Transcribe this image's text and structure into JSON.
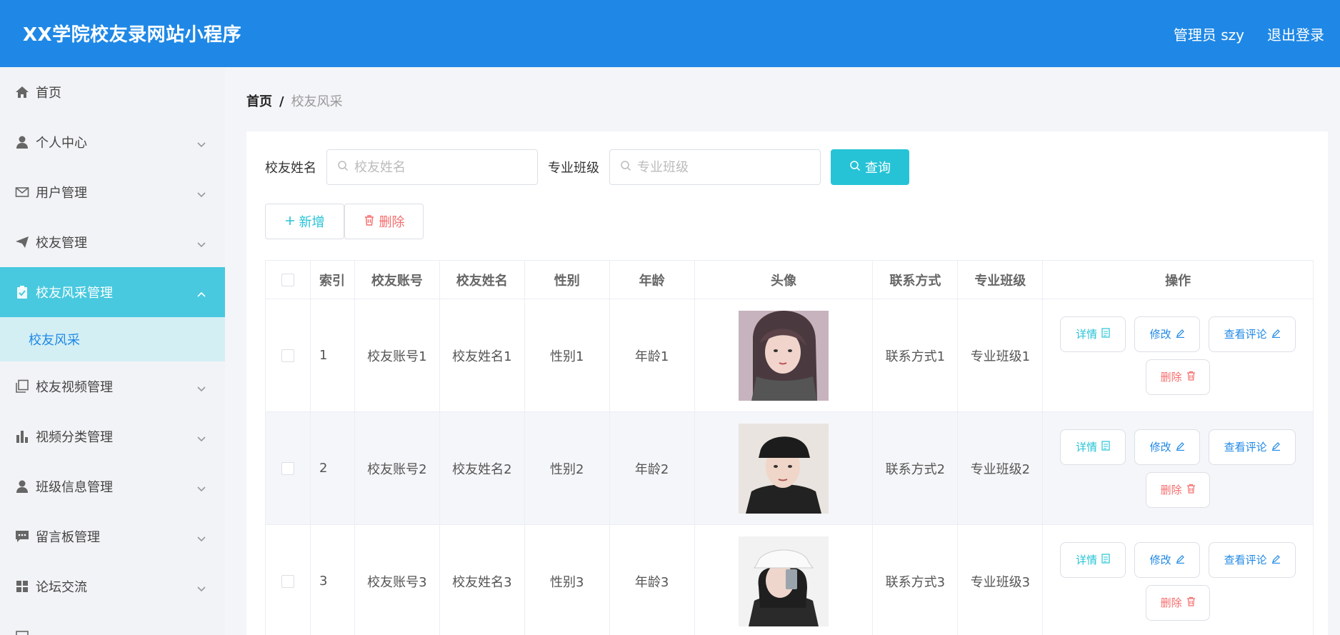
{
  "header": {
    "title": "XX学院校友录网站小程序",
    "user": "管理员 szy",
    "logout": "退出登录"
  },
  "sidebar": {
    "items": [
      {
        "label": "首页",
        "icon": "home-icon"
      },
      {
        "label": "个人中心",
        "icon": "user-icon"
      },
      {
        "label": "用户管理",
        "icon": "mail-icon"
      },
      {
        "label": "校友管理",
        "icon": "send-icon"
      },
      {
        "label": "校友风采管理",
        "icon": "clipboard-icon"
      },
      {
        "label": "校友视频管理",
        "icon": "copy-icon"
      },
      {
        "label": "视频分类管理",
        "icon": "bar-chart-icon"
      },
      {
        "label": "班级信息管理",
        "icon": "user-icon"
      },
      {
        "label": "留言板管理",
        "icon": "message-icon"
      },
      {
        "label": "论坛交流",
        "icon": "grid-icon"
      }
    ],
    "active_sub": "校友风采"
  },
  "breadcrumb": {
    "home": "首页",
    "sep": "/",
    "current": "校友风采"
  },
  "search": {
    "name_label": "校友姓名",
    "name_placeholder": "校友姓名",
    "class_label": "专业班级",
    "class_placeholder": "专业班级",
    "query_label": "查询"
  },
  "actions": {
    "add_label": "新增",
    "delete_label": "删除"
  },
  "table": {
    "headers": [
      "索引",
      "校友账号",
      "校友姓名",
      "性别",
      "年龄",
      "头像",
      "联系方式",
      "专业班级",
      "操作"
    ],
    "rows": [
      {
        "index": "1",
        "account": "校友账号1",
        "name": "校友姓名1",
        "gender": "性别1",
        "age": "年龄1",
        "contact": "联系方式1",
        "class": "专业班级1"
      },
      {
        "index": "2",
        "account": "校友账号2",
        "name": "校友姓名2",
        "gender": "性别2",
        "age": "年龄2",
        "contact": "联系方式2",
        "class": "专业班级2"
      },
      {
        "index": "3",
        "account": "校友账号3",
        "name": "校友姓名3",
        "gender": "性别3",
        "age": "年龄3",
        "contact": "联系方式3",
        "class": "专业班级3"
      }
    ],
    "ops": {
      "detail": "详情",
      "edit": "修改",
      "comment": "查看评论",
      "delete": "删除"
    }
  },
  "colors": {
    "header_bg": "#1f88e6",
    "accent": "#26c3d6",
    "active_menu": "#48c9df",
    "danger": "#f56c6c"
  }
}
